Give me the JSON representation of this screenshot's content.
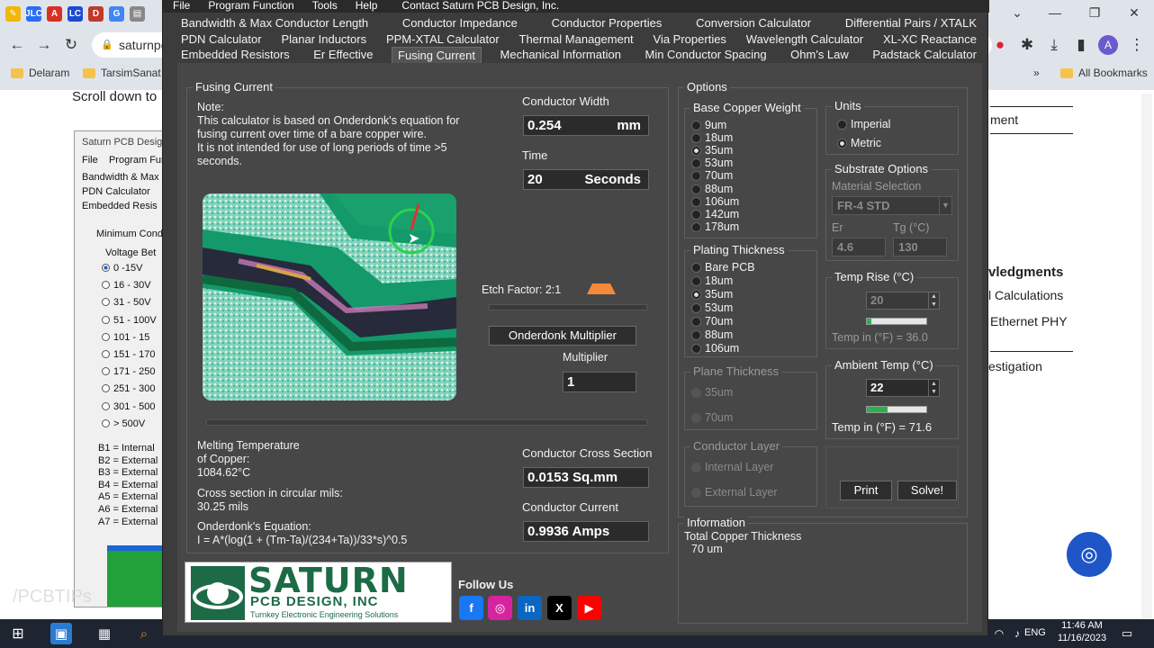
{
  "browser": {
    "url": "saturnpo",
    "bookmarks": [
      "Delaram",
      "TarsimSanat"
    ],
    "all_bookmarks": "All Bookmarks",
    "favicons": [
      "JLC",
      "A",
      "LC",
      "D",
      "G"
    ],
    "page": {
      "scroll_hint": "Scroll down to",
      "right_items": [
        "ment",
        "vledgments",
        "l Calculations",
        "Ethernet PHY",
        "estigation"
      ]
    },
    "inner_window": {
      "title": "Saturn PCB Desig",
      "menu": [
        "File",
        "Program Functi"
      ],
      "tabs": [
        "Bandwidth & Max",
        "PDN Calculator",
        "Embedded Resis"
      ],
      "group": "Minimum Cond",
      "subgroup": "Voltage Bet",
      "options": [
        "0 -15V",
        "16 - 30V",
        "31 - 50V",
        "51 - 100V",
        "101 - 15",
        "151 - 170",
        "171 - 250",
        "251 - 300",
        "301 - 500",
        "> 500V"
      ],
      "legend": [
        "B1 = Internal",
        "B2 = External",
        "B3 = External",
        "B4 = External",
        "A5 = External",
        "A6 = External",
        "A7 = External"
      ]
    },
    "watermark": "/PCBTIPs"
  },
  "taskbar": {
    "language": "ENG",
    "time": "11:46 AM",
    "date": "11/16/2023"
  },
  "app": {
    "menu": [
      "File",
      "Program Function",
      "Tools",
      "Help",
      "Contact Saturn PCB Design, Inc."
    ],
    "tab_rows": [
      [
        "Bandwidth & Max Conductor Length",
        "Conductor Impedance",
        "Conductor Properties",
        "Conversion Calculator",
        "Differential Pairs / XTALK"
      ],
      [
        "PDN Calculator",
        "Planar Inductors",
        "PPM-XTAL Calculator",
        "Thermal Management",
        "Via Properties",
        "Wavelength Calculator",
        "XL-XC Reactance"
      ],
      [
        "Embedded Resistors",
        "Er Effective",
        "Fusing Current",
        "Mechanical Information",
        "Min Conductor Spacing",
        "Ohm's Law",
        "Padstack Calculator"
      ]
    ],
    "active_tab": "Fusing Current",
    "fusing": {
      "group_title": "Fusing Current",
      "note": [
        "Note:",
        "This calculator is based on Onderdonk's equation for",
        "fusing current over time of a bare copper wire.",
        "It is not intended for use of long periods of time >5",
        "seconds."
      ],
      "conductor_width_label": "Conductor Width",
      "conductor_width_value": "0.254",
      "conductor_width_unit": "mm",
      "time_label": "Time",
      "time_value": "20",
      "time_unit": "Seconds",
      "etch_factor": "Etch Factor: 2:1",
      "onderdonk_button": "Onderdonk Multiplier",
      "multiplier_label": "Multiplier",
      "multiplier_value": "1",
      "melting_temp": [
        "Melting Temperature",
        "of Copper:",
        "1084.62°C"
      ],
      "cross_section_mils": [
        "Cross section in circular mils:",
        "30.25 mils"
      ],
      "equation": [
        "Onderdonk's Equation:",
        "I = A*(log(1 + (Tm-Ta)/(234+Ta))/33*s)^0.5"
      ],
      "cross_section_label": "Conductor Cross Section",
      "cross_section_value": "0.0153 Sq.mm",
      "current_label": "Conductor Current",
      "current_value": "0.9936 Amps",
      "follow_us": "Follow Us",
      "logo": {
        "line1": "SATURN",
        "line2": "PCB DESIGN, INC",
        "line3": "Turnkey Electronic Engineering Solutions"
      },
      "social_icons": [
        "facebook-icon",
        "instagram-icon",
        "linkedin-icon",
        "x-icon",
        "youtube-icon"
      ]
    },
    "options": {
      "title": "Options",
      "base_copper": {
        "title": "Base Copper Weight",
        "items": [
          "9um",
          "18um",
          "35um",
          "53um",
          "70um",
          "88um",
          "106um",
          "142um",
          "178um"
        ],
        "selected": "35um"
      },
      "units": {
        "title": "Units",
        "items": [
          "Imperial",
          "Metric"
        ],
        "selected": "Metric"
      },
      "substrate": {
        "title": "Substrate Options",
        "material_label": "Material Selection",
        "material_value": "FR-4 STD",
        "er_label": "Er",
        "er_value": "4.6",
        "tg_label": "Tg (°C)",
        "tg_value": "130"
      },
      "plating": {
        "title": "Plating Thickness",
        "items": [
          "Bare PCB",
          "18um",
          "35um",
          "53um",
          "70um",
          "88um",
          "106um"
        ],
        "selected": "35um"
      },
      "temp_rise": {
        "title": "Temp Rise (°C)",
        "value": "20",
        "slider": 0.08,
        "fahrenheit": "Temp in (°F) = 36.0"
      },
      "plane_thickness": {
        "title": "Plane Thickness",
        "items": [
          "35um",
          "70um"
        ]
      },
      "ambient": {
        "title": "Ambient Temp (°C)",
        "value": "22",
        "slider": 0.35,
        "fahrenheit": "Temp in (°F) = 71.6"
      },
      "conductor_layer": {
        "title": "Conductor Layer",
        "items": [
          "Internal Layer",
          "External Layer"
        ]
      },
      "print_button": "Print",
      "solve_button": "Solve!"
    },
    "information": {
      "title": "Information",
      "lines": [
        "Total Copper Thickness",
        "70 um"
      ]
    }
  }
}
